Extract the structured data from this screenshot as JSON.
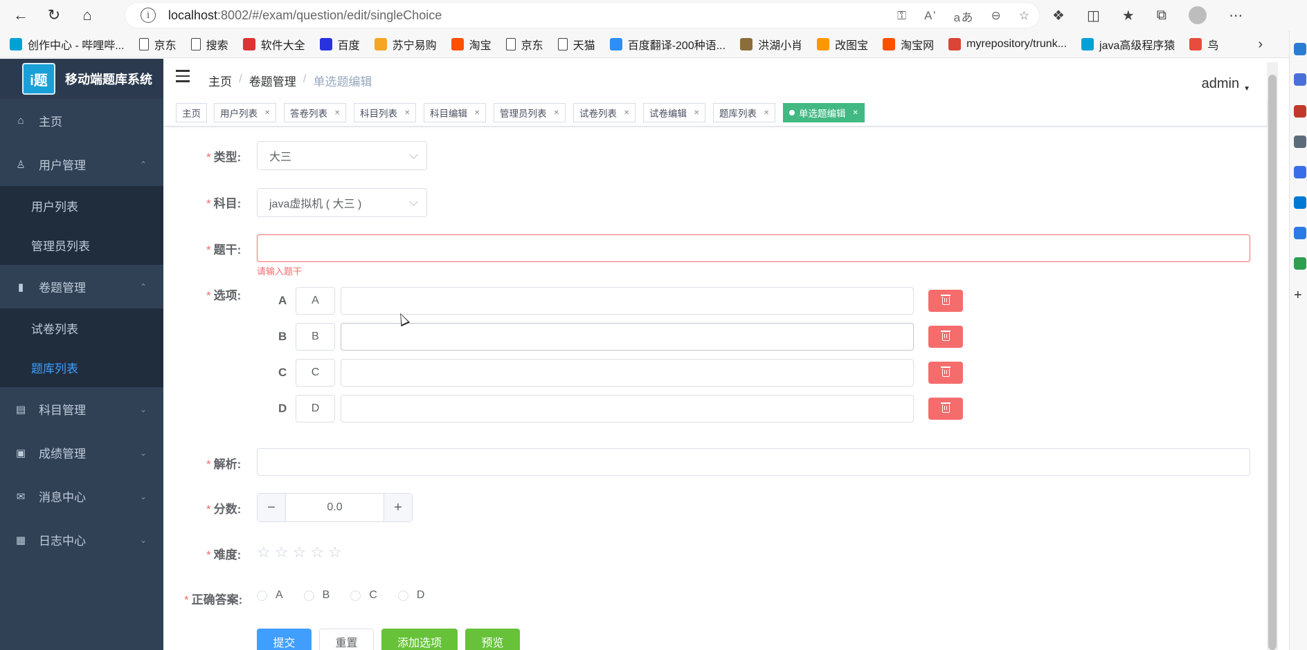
{
  "browser": {
    "url_host": "localhost",
    "url_path": ":8002/#/exam/question/edit/singleChoice",
    "info_icon": "info-icon"
  },
  "bookmarks": [
    {
      "label": "创作中心 - 哔哩哔...",
      "icon": "bilibili-icon",
      "color": "#00a1d6"
    },
    {
      "label": "京东",
      "icon": "page-icon",
      "color": ""
    },
    {
      "label": "搜索",
      "icon": "page-icon",
      "color": ""
    },
    {
      "label": "软件大全",
      "icon": "software-icon",
      "color": "#d33"
    },
    {
      "label": "百度",
      "icon": "baidu-icon",
      "color": "#2932e1"
    },
    {
      "label": "苏宁易购",
      "icon": "suning-icon",
      "color": "#f5a623"
    },
    {
      "label": "淘宝",
      "icon": "taobao-icon",
      "color": "#ff5000"
    },
    {
      "label": "京东",
      "icon": "page-icon",
      "color": ""
    },
    {
      "label": "天猫",
      "icon": "page-icon",
      "color": ""
    },
    {
      "label": "百度翻译-200种语...",
      "icon": "translate-icon",
      "color": "#2e8ef7"
    },
    {
      "label": "洪湖小肖",
      "icon": "bird-icon",
      "color": "#8a6d3b"
    },
    {
      "label": "改图宝",
      "icon": "gaitubao-icon",
      "color": "#ff9800"
    },
    {
      "label": "淘宝网",
      "icon": "taobao-icon",
      "color": "#ff5000"
    },
    {
      "label": "myrepository/trunk...",
      "icon": "chrome-icon",
      "color": "#db4437"
    },
    {
      "label": "java高级程序猿",
      "icon": "bilibili-icon",
      "color": "#00a1d6"
    },
    {
      "label": "鸟",
      "icon": "bird-icon",
      "color": "#e74c3c"
    }
  ],
  "sidebar": {
    "logo_text": "移动端题库系统",
    "logo_mark": "i题",
    "items": [
      {
        "label": "主页",
        "icon": "home-icon"
      },
      {
        "label": "用户管理",
        "icon": "user-icon",
        "expanded": true,
        "children": [
          "用户列表",
          "管理员列表"
        ]
      },
      {
        "label": "卷题管理",
        "icon": "book-icon",
        "expanded": true,
        "children": [
          "试卷列表",
          "题库列表"
        ]
      },
      {
        "label": "科目管理",
        "icon": "book-open-icon"
      },
      {
        "label": "成绩管理",
        "icon": "chat-icon"
      },
      {
        "label": "消息中心",
        "icon": "mail-icon"
      },
      {
        "label": "日志中心",
        "icon": "log-icon"
      }
    ],
    "active_child": "题库列表"
  },
  "header": {
    "breadcrumb": [
      "主页",
      "卷题管理",
      "单选题编辑"
    ],
    "user": "admin"
  },
  "tags": [
    "主页",
    "用户列表",
    "答卷列表",
    "科目列表",
    "科目编辑",
    "管理员列表",
    "试卷列表",
    "试卷编辑",
    "题库列表",
    "单选题编辑"
  ],
  "form": {
    "type_label": "类型:",
    "type_value": "大三",
    "subject_label": "科目:",
    "subject_value": "java虚拟机 ( 大三 )",
    "stem_label": "题干:",
    "stem_value": "",
    "stem_error": "请输入题干",
    "options_label": "选项:",
    "options": [
      {
        "letter": "A",
        "prefix": "A",
        "value": ""
      },
      {
        "letter": "B",
        "prefix": "B",
        "value": ""
      },
      {
        "letter": "C",
        "prefix": "C",
        "value": ""
      },
      {
        "letter": "D",
        "prefix": "D",
        "value": ""
      }
    ],
    "analysis_label": "解析:",
    "analysis_value": "",
    "score_label": "分数:",
    "score_value": "0.0",
    "difficulty_label": "难度:",
    "difficulty_rating": 0,
    "difficulty_max": 5,
    "answer_label": "正确答案:",
    "answer_choices": [
      "A",
      "B",
      "C",
      "D"
    ],
    "buttons": {
      "submit": "提交",
      "reset": "重置",
      "add_option": "添加选项",
      "preview": "预览"
    }
  },
  "colors": {
    "sidebar_bg": "#304156",
    "active_tag": "#42b983",
    "primary": "#409eff",
    "danger": "#f56c6c",
    "success": "#67c23a"
  }
}
